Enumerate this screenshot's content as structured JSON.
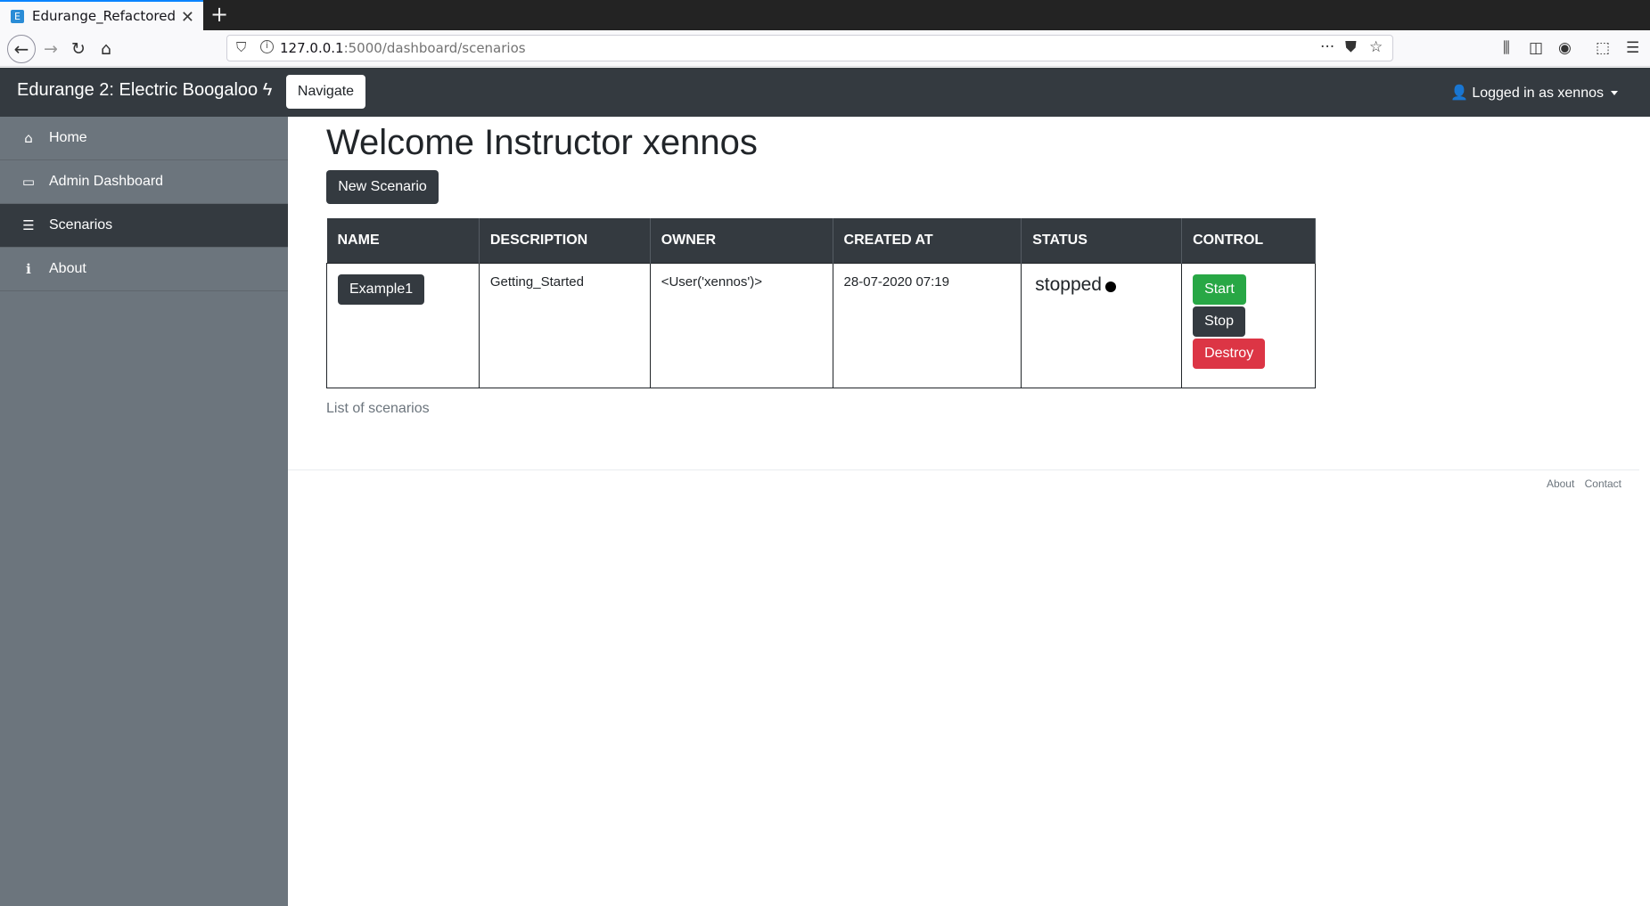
{
  "browser": {
    "tab_title": "Edurange_Refactored",
    "favicon_letter": "E",
    "url_host": "127.0.0.1",
    "url_path": ":5000/dashboard/scenarios"
  },
  "header": {
    "brand": "Edurange 2: Electric Boogaloo",
    "navigate_label": "Navigate",
    "user_label": "Logged in as xennos"
  },
  "sidebar": {
    "items": [
      {
        "label": "Home",
        "icon": "home-icon"
      },
      {
        "label": "Admin Dashboard",
        "icon": "monitor-icon"
      },
      {
        "label": "Scenarios",
        "icon": "list-icon",
        "active": true
      },
      {
        "label": "About",
        "icon": "info-icon"
      }
    ]
  },
  "main": {
    "title": "Welcome Instructor xennos",
    "new_scenario_label": "New Scenario",
    "table": {
      "headers": [
        "NAME",
        "DESCRIPTION",
        "OWNER",
        "CREATED AT",
        "STATUS",
        "CONTROL"
      ],
      "rows": [
        {
          "name": "Example1",
          "description": "Getting_Started",
          "owner": "<User('xennos')>",
          "created_at": "28-07-2020 07:19",
          "status": "stopped",
          "controls": {
            "start": "Start",
            "stop": "Stop",
            "destroy": "Destroy"
          }
        }
      ]
    },
    "caption": "List of scenarios"
  },
  "footer": {
    "about": "About",
    "contact": "Contact"
  },
  "colors": {
    "dark": "#343a40",
    "sidebar": "#6c757d",
    "start": "#28a745",
    "destroy": "#dc3545"
  }
}
